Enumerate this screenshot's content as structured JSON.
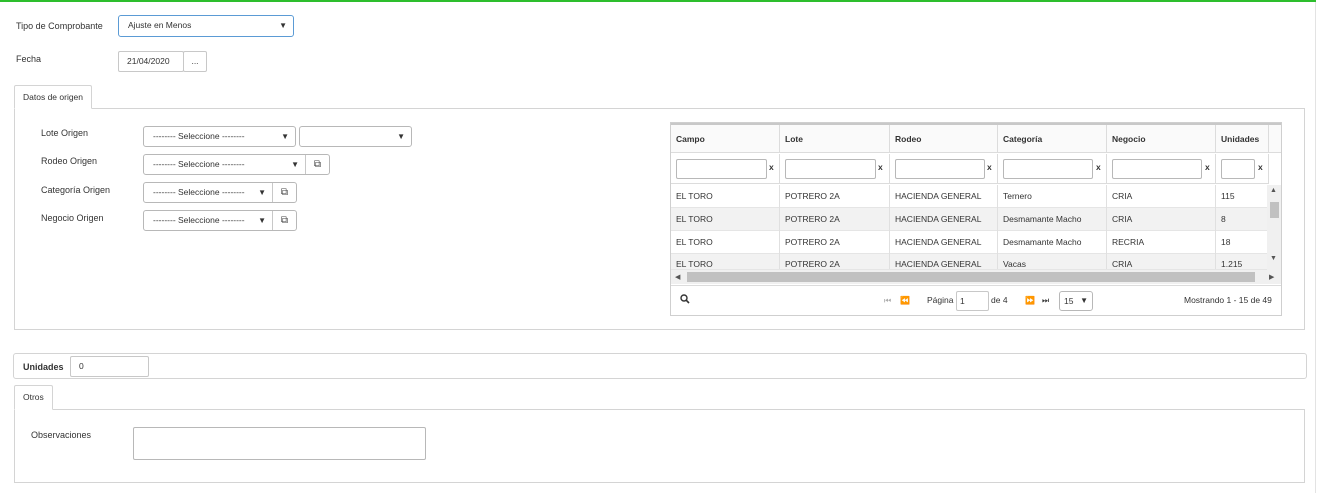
{
  "header": {
    "tipo_label": "Tipo de Comprobante",
    "tipo_value": "Ajuste en Menos",
    "fecha_label": "Fecha",
    "fecha_value": "21/04/2020",
    "fecha_button": "..."
  },
  "origen": {
    "tab_label": "Datos de origen",
    "lote_label": "Lote Origen",
    "lote_select": "-------- Seleccione --------",
    "lote_select2": "",
    "rodeo_label": "Rodeo Origen",
    "rodeo_select": "-------- Seleccione --------",
    "categoria_label": "Categoría Origen",
    "categoria_select": "-------- Seleccione --------",
    "negocio_label": "Negocio Origen",
    "negocio_select": "-------- Seleccione --------"
  },
  "grid": {
    "columns": [
      "Campo",
      "Lote",
      "Rodeo",
      "Categoría",
      "Negocio",
      "Unidades"
    ],
    "filter_clear": "x",
    "rows": [
      [
        "EL TORO",
        "POTRERO 2A",
        "HACIENDA GENERAL",
        "Ternero",
        "CRIA",
        "115"
      ],
      [
        "EL TORO",
        "POTRERO 2A",
        "HACIENDA GENERAL",
        "Desmamante Macho",
        "CRIA",
        "8"
      ],
      [
        "EL TORO",
        "POTRERO 2A",
        "HACIENDA GENERAL",
        "Desmamante Macho",
        "RECRIA",
        "18"
      ],
      [
        "EL TORO",
        "POTRERO 2A",
        "HACIENDA GENERAL",
        "Vacas",
        "CRIA",
        "1.215"
      ]
    ],
    "pager": {
      "page_label": "Página",
      "page_value": "1",
      "of_label": "de 4",
      "page_size": "15",
      "showing": "Mostrando 1 - 15 de 49"
    }
  },
  "unidades": {
    "label": "Unidades",
    "value": "0"
  },
  "otros": {
    "tab_label": "Otros",
    "observaciones_label": "Observaciones",
    "observaciones_value": ""
  },
  "icons": {
    "dropdown": "▼",
    "external": "external-link-icon",
    "search": "search-icon"
  },
  "colors": {
    "accent_top": "#2dbe2d",
    "focus_border": "#5b9bd5"
  }
}
